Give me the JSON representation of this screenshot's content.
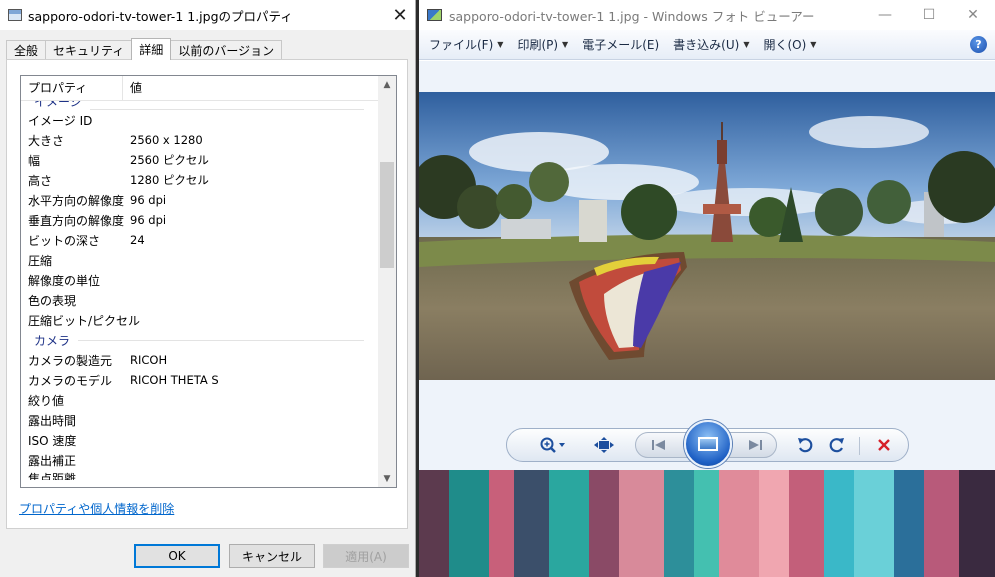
{
  "dialog": {
    "title": "sapporo-odori-tv-tower-1 1.jpgのプロパティ",
    "tabs": [
      "全般",
      "セキュリティ",
      "詳細",
      "以前のバージョン"
    ],
    "active_tab": "詳細",
    "columns": {
      "property": "プロパティ",
      "value": "値"
    },
    "sections": [
      {
        "name": "イメージ",
        "rows": [
          {
            "key": "イメージ ID",
            "value": ""
          },
          {
            "key": "大きさ",
            "value": "2560 x 1280"
          },
          {
            "key": "幅",
            "value": "2560 ピクセル"
          },
          {
            "key": "高さ",
            "value": "1280 ピクセル"
          },
          {
            "key": "水平方向の解像度",
            "value": "96 dpi"
          },
          {
            "key": "垂直方向の解像度",
            "value": "96 dpi"
          },
          {
            "key": "ビットの深さ",
            "value": "24"
          },
          {
            "key": "圧縮",
            "value": ""
          },
          {
            "key": "解像度の単位",
            "value": ""
          },
          {
            "key": "色の表現",
            "value": ""
          },
          {
            "key": "圧縮ビット/ピクセル",
            "value": ""
          }
        ]
      },
      {
        "name": "カメラ",
        "rows": [
          {
            "key": "カメラの製造元",
            "value": "RICOH"
          },
          {
            "key": "カメラのモデル",
            "value": "RICOH THETA S"
          },
          {
            "key": "絞り値",
            "value": ""
          },
          {
            "key": "露出時間",
            "value": ""
          },
          {
            "key": "ISO 速度",
            "value": ""
          },
          {
            "key": "露出補正",
            "value": ""
          },
          {
            "key": "焦点距離",
            "value": ""
          }
        ]
      }
    ],
    "remove_link": "プロパティや個人情報を削除",
    "buttons": {
      "ok": "OK",
      "cancel": "キャンセル",
      "apply": "適用(A)"
    }
  },
  "viewer": {
    "title": "sapporo-odori-tv-tower-1 1.jpg - Windows フォト ビューアー",
    "menu": [
      {
        "label": "ファイル(F)",
        "has_caret": true
      },
      {
        "label": "印刷(P)",
        "has_caret": true
      },
      {
        "label": "電子メール(E)",
        "has_caret": false
      },
      {
        "label": "書き込み(U)",
        "has_caret": true
      },
      {
        "label": "開く(O)",
        "has_caret": true
      }
    ],
    "help_label": "?",
    "accent": "#1d5fc4",
    "delete_color": "#d6202a"
  }
}
